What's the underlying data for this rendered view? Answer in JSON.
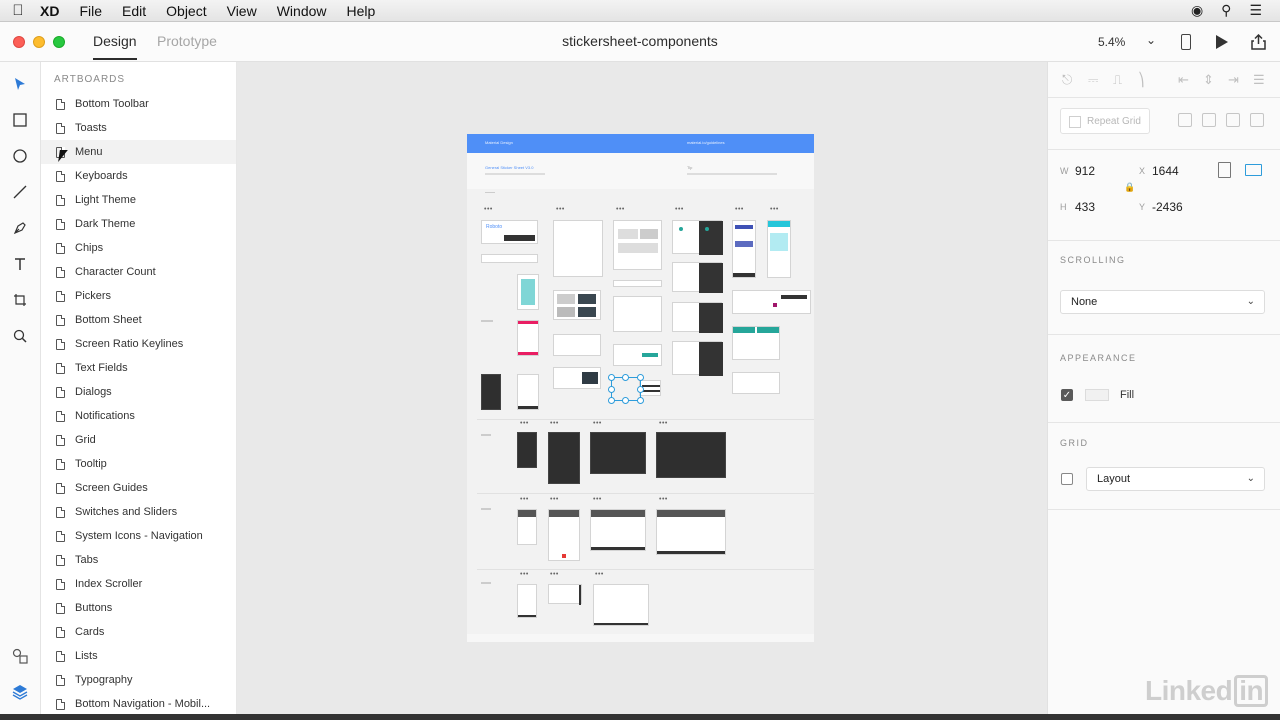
{
  "menubar": {
    "app": "XD",
    "items": [
      "File",
      "Edit",
      "Object",
      "View",
      "Window",
      "Help"
    ]
  },
  "window": {
    "tabs": {
      "design": "Design",
      "prototype": "Prototype"
    },
    "title": "stickersheet-components",
    "zoom": "5.4%"
  },
  "panel": {
    "header": "ARTBOARDS",
    "artboards": [
      "Bottom Toolbar",
      "Toasts",
      "Menu",
      "Keyboards",
      "Light Theme",
      "Dark Theme",
      "Chips",
      "Character Count",
      "Pickers",
      "Bottom Sheet",
      "Screen Ratio Keylines",
      "Text Fields",
      "Dialogs",
      "Notifications",
      "Grid",
      "Tooltip",
      "Screen Guides",
      "Switches and Sliders",
      "System Icons - Navigation",
      "Tabs",
      "Index Scroller",
      "Buttons",
      "Cards",
      "Lists",
      "Typography",
      "Bottom Navigation - Mobil..."
    ]
  },
  "canvas": {
    "banner_left": "Material Design",
    "banner_right": "material.io/guidelines",
    "sheet_title": "General Sticker Sheet V3.0",
    "sheet_note": "Tip"
  },
  "inspector": {
    "repeat_grid": "Repeat Grid",
    "w_label": "W",
    "w": "912",
    "x_label": "X",
    "x": "1644",
    "h_label": "H",
    "h": "433",
    "y_label": "Y",
    "y": "-2436",
    "scrolling_header": "SCROLLING",
    "scrolling_value": "None",
    "appearance_header": "APPEARANCE",
    "fill_label": "Fill",
    "fill_checked": true,
    "grid_header": "GRID",
    "grid_value": "Layout",
    "grid_checked": false
  },
  "watermark": {
    "text": "Linked",
    "badge": "in"
  },
  "colors": {
    "accent": "#2d9cdb",
    "banner": "#4f8ff7",
    "canvas": "#e9e9e9"
  }
}
